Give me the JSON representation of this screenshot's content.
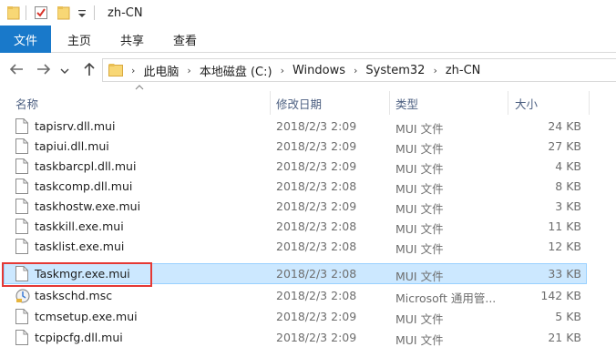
{
  "window": {
    "title": "zh-CN"
  },
  "ribbon": {
    "tabs": [
      {
        "label": "文件"
      },
      {
        "label": "主页"
      },
      {
        "label": "共享"
      },
      {
        "label": "查看"
      }
    ]
  },
  "address": {
    "crumbs": [
      "此电脑",
      "本地磁盘 (C:)",
      "Windows",
      "System32",
      "zh-CN"
    ]
  },
  "columns": {
    "name": "名称",
    "date": "修改日期",
    "type": "类型",
    "size": "大小"
  },
  "files": [
    {
      "name": "tapisrv.dll.mui",
      "date": "2018/2/3 2:09",
      "type": "MUI 文件",
      "size": "24 KB",
      "icon": "file-icon",
      "selected": false
    },
    {
      "name": "tapiui.dll.mui",
      "date": "2018/2/3 2:09",
      "type": "MUI 文件",
      "size": "27 KB",
      "icon": "file-icon",
      "selected": false
    },
    {
      "name": "taskbarcpl.dll.mui",
      "date": "2018/2/3 2:09",
      "type": "MUI 文件",
      "size": "4 KB",
      "icon": "file-icon",
      "selected": false
    },
    {
      "name": "taskcomp.dll.mui",
      "date": "2018/2/3 2:08",
      "type": "MUI 文件",
      "size": "8 KB",
      "icon": "file-icon",
      "selected": false
    },
    {
      "name": "taskhostw.exe.mui",
      "date": "2018/2/3 2:09",
      "type": "MUI 文件",
      "size": "3 KB",
      "icon": "file-icon",
      "selected": false
    },
    {
      "name": "taskkill.exe.mui",
      "date": "2018/2/3 2:08",
      "type": "MUI 文件",
      "size": "11 KB",
      "icon": "file-icon",
      "selected": false
    },
    {
      "name": "tasklist.exe.mui",
      "date": "2018/2/3 2:08",
      "type": "MUI 文件",
      "size": "12 KB",
      "icon": "file-icon",
      "selected": false
    },
    {
      "name": "Taskmgr.exe.mui",
      "date": "2018/2/3 2:08",
      "type": "MUI 文件",
      "size": "33 KB",
      "icon": "file-icon",
      "selected": true
    },
    {
      "name": "taskschd.msc",
      "date": "2018/2/3 2:08",
      "type": "Microsoft 通用管...",
      "size": "142 KB",
      "icon": "scheduler-icon",
      "selected": false
    },
    {
      "name": "tcmsetup.exe.mui",
      "date": "2018/2/3 2:09",
      "type": "MUI 文件",
      "size": "5 KB",
      "icon": "file-icon",
      "selected": false
    },
    {
      "name": "tcpipcfg.dll.mui",
      "date": "2018/2/3 2:09",
      "type": "MUI 文件",
      "size": "21 KB",
      "icon": "file-icon",
      "selected": false
    }
  ],
  "colors": {
    "accent": "#1979ca",
    "selection": "#cce8ff",
    "highlight": "#e53935",
    "folder": "#f8d775"
  }
}
